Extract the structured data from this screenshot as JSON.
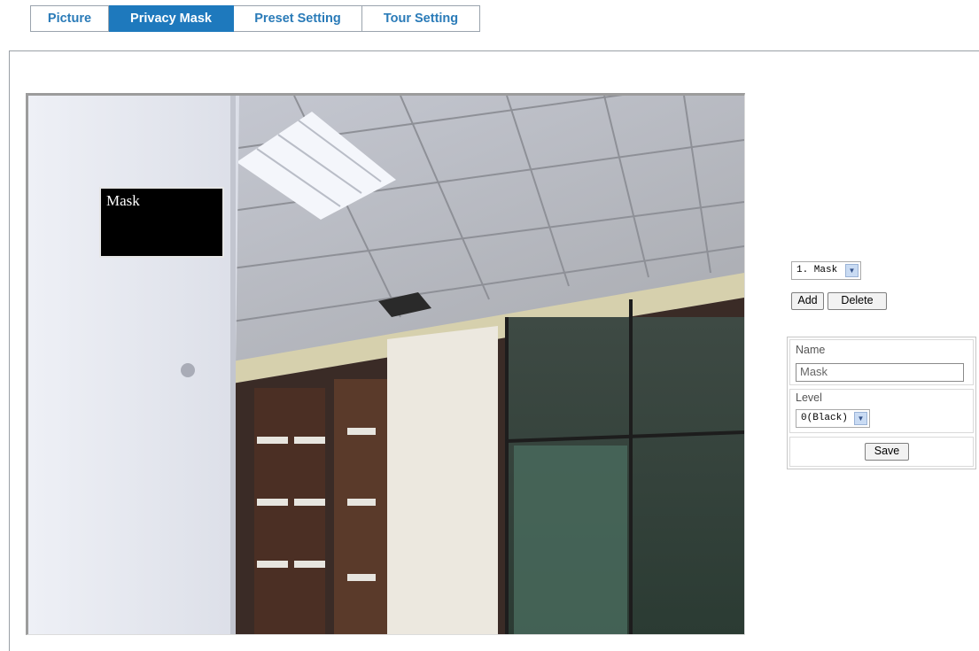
{
  "tabs": [
    {
      "label": "Picture",
      "active": false
    },
    {
      "label": "Privacy Mask",
      "active": true
    },
    {
      "label": "Preset Setting",
      "active": false
    },
    {
      "label": "Tour Setting",
      "active": false
    }
  ],
  "video": {
    "mask_overlay_label": "Mask"
  },
  "mask_list": {
    "selected": "1. Mask",
    "add_label": "Add",
    "delete_label": "Delete"
  },
  "properties": {
    "name_label": "Name",
    "name_value": "Mask",
    "level_label": "Level",
    "level_value": "0(Black)",
    "save_label": "Save"
  },
  "colors": {
    "active_tab": "#1e79bd",
    "tab_text": "#2a7bb8",
    "mask_fill": "#000000"
  }
}
